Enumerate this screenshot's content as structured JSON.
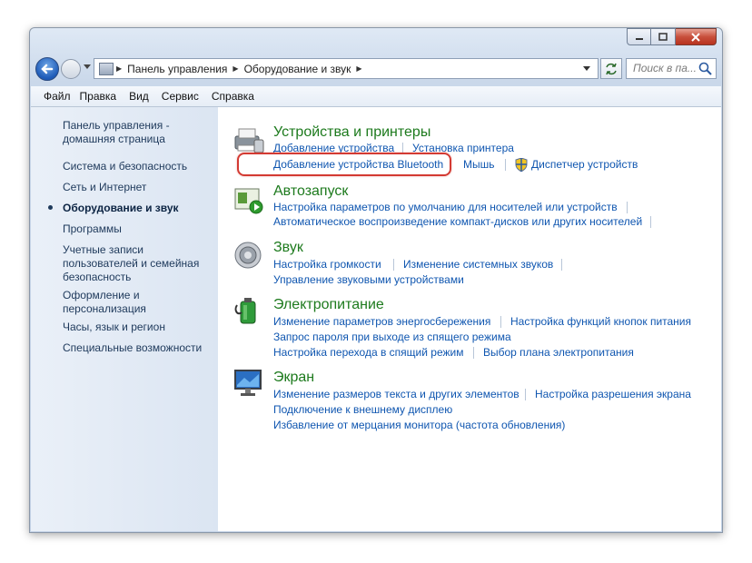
{
  "window": {
    "caption_buttons": {
      "minimize": "minimize-icon",
      "maximize": "maximize-icon",
      "close": "close-icon"
    }
  },
  "navigation": {
    "breadcrumb": [
      "Панель управления",
      "Оборудование и звук"
    ],
    "search_placeholder": "Поиск в па..."
  },
  "menu": [
    "Файл",
    "Правка",
    "Вид",
    "Сервис",
    "Справка"
  ],
  "sidebar": {
    "items": [
      {
        "label_line1": "Панель управления -",
        "label_line2": "домашняя страница"
      },
      {
        "label": "Система и безопасность"
      },
      {
        "label": "Сеть и Интернет"
      },
      {
        "label": "Оборудование и звук",
        "active": true
      },
      {
        "label": "Программы"
      },
      {
        "label_line1": "Учетные записи",
        "label_line2": "пользователей и семейная",
        "label_line3": "безопасность"
      },
      {
        "label_line1": "Оформление и",
        "label_line2": "персонализация"
      },
      {
        "label": "Часы, язык и регион"
      },
      {
        "label": "Специальные возможности"
      }
    ]
  },
  "categories": [
    {
      "title": "Устройства и принтеры",
      "icon": "printer-icon",
      "links": [
        "Добавление устройства",
        "Установка принтера",
        "Добавление устройства Bluetooth",
        "Мышь",
        "Диспетчер устройств"
      ]
    },
    {
      "title": "Автозапуск",
      "icon": "autoplay-icon",
      "links": [
        "Настройка параметров по умолчанию для носителей или устройств",
        "Автоматическое воспроизведение компакт-дисков или других носителей"
      ]
    },
    {
      "title": "Звук",
      "icon": "speaker-icon",
      "links": [
        "Настройка громкости",
        "Изменение системных звуков",
        "Управление звуковыми устройствами"
      ]
    },
    {
      "title": "Электропитание",
      "icon": "battery-icon",
      "links": [
        "Изменение параметров энергосбережения",
        "Настройка функций кнопок питания",
        "Запрос пароля при выходе из спящего режима",
        "Настройка перехода в спящий режим",
        "Выбор плана электропитания"
      ]
    },
    {
      "title": "Экран",
      "icon": "monitor-icon",
      "links": [
        "Изменение размеров текста и других элементов",
        "Настройка разрешения экрана",
        "Подключение к внешнему дисплею",
        "Избавление от мерцания монитора (частота обновления)"
      ]
    }
  ],
  "colors": {
    "category_title": "#1d7a1d",
    "link": "#0f56b0",
    "highlight": "#d33a32"
  }
}
